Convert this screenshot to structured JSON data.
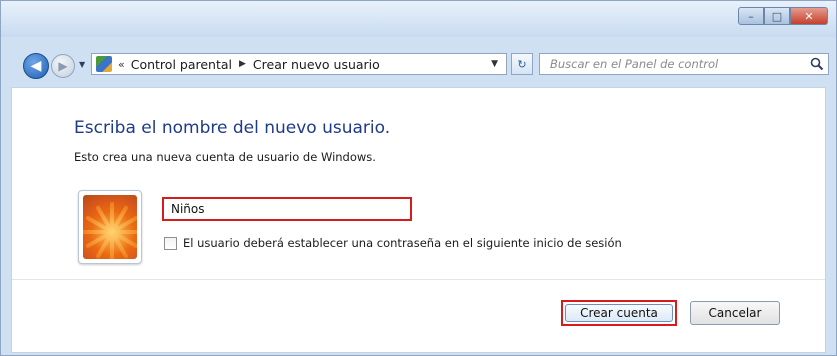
{
  "window": {
    "caption": {
      "minimize_glyph": "–",
      "maximize_glyph": "□",
      "close_glyph": "✕"
    }
  },
  "nav": {
    "back_glyph": "◀",
    "forward_glyph": "▶",
    "history_glyph": "▼",
    "address": {
      "chevron": "«",
      "crumbs": [
        "Control parental",
        "Crear nuevo usuario"
      ],
      "separator": "▶",
      "dropdown_glyph": "▼"
    },
    "refresh_glyph": "↻",
    "search": {
      "placeholder": "Buscar en el Panel de control"
    }
  },
  "main": {
    "heading": "Escriba el nombre del nuevo usuario.",
    "subtext": "Esto crea una nueva cuenta de usuario de Windows.",
    "name_value": "Niños",
    "password_checkbox_label": "El usuario deberá establecer una contraseña en el siguiente inicio de sesión",
    "password_checkbox_checked": false,
    "create_button": "Crear cuenta",
    "cancel_button": "Cancelar"
  },
  "colors": {
    "highlight_red": "#d81b1b",
    "heading_blue": "#1e3a8a"
  }
}
